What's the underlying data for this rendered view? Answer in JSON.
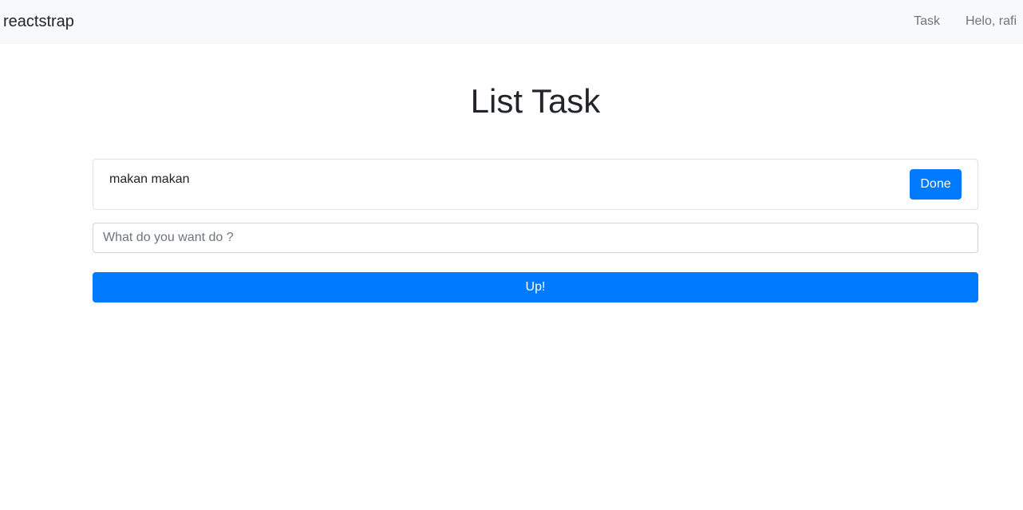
{
  "navbar": {
    "brand": "reactstrap",
    "links": [
      {
        "label": "Task"
      },
      {
        "label": "Helo, rafi"
      }
    ]
  },
  "main": {
    "title": "List Task",
    "tasks": [
      {
        "text": "makan makan",
        "action_label": "Done"
      }
    ],
    "input": {
      "value": "",
      "placeholder": "What do you want do ?"
    },
    "submit_label": "Up!"
  },
  "colors": {
    "primary": "#007bff",
    "navbar_bg": "#f8f9fa",
    "nav_link": "#6c757d",
    "text": "#212529"
  }
}
